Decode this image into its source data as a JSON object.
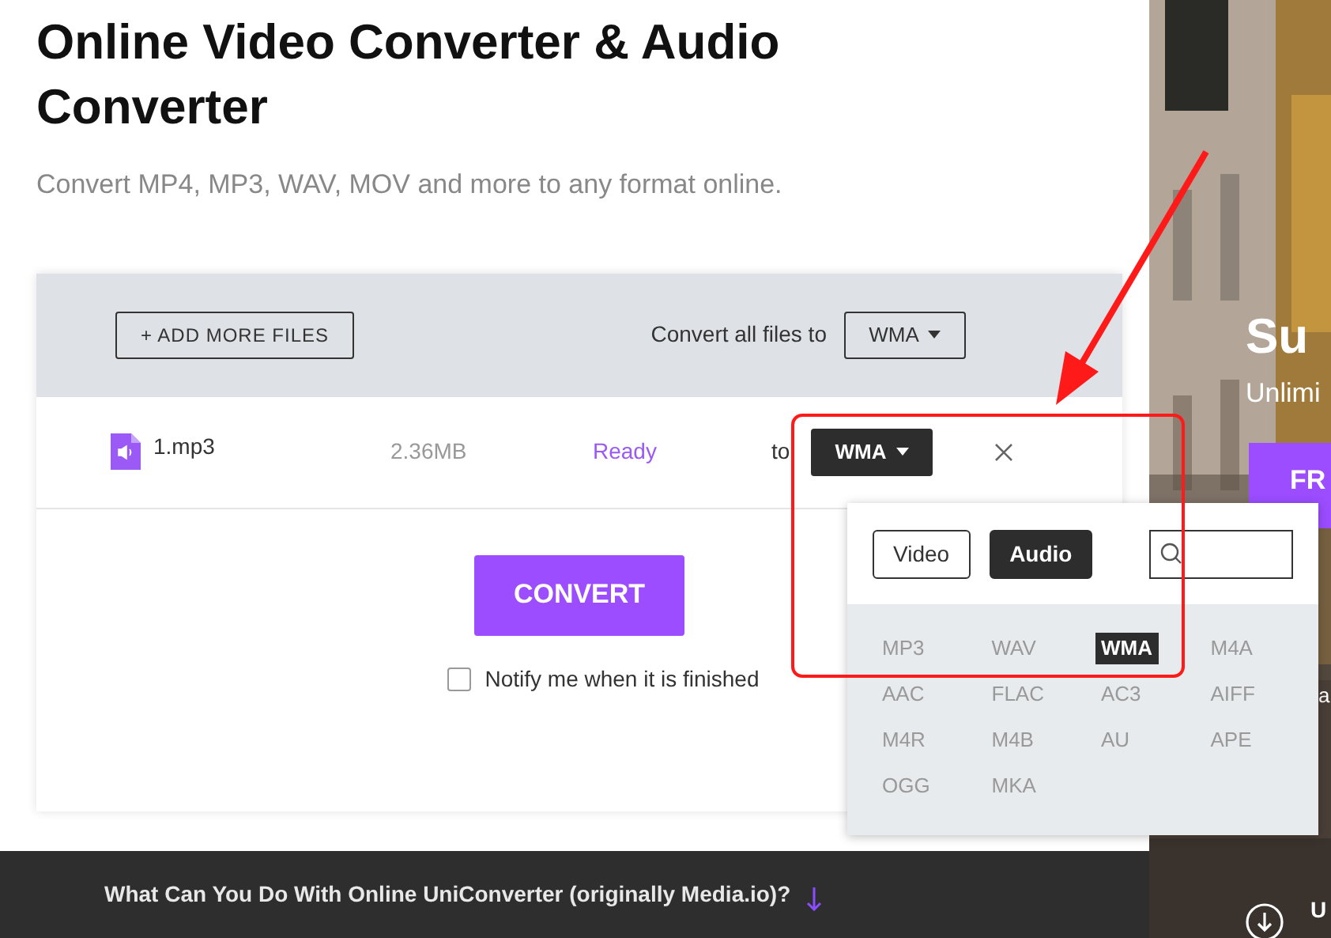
{
  "title": "Online Video Converter & Audio Converter",
  "subtitle": "Convert MP4, MP3, WAV, MOV and more to any format online.",
  "converter": {
    "add_button": "+ ADD MORE FILES",
    "convert_all_label": "Convert all files to",
    "convert_all_format": "WMA",
    "file": {
      "name": "1.mp3",
      "size": "2.36MB",
      "status": "Ready",
      "to_label": "to",
      "format": "WMA"
    },
    "convert_button": "CONVERT",
    "notify": {
      "label": "Notify me when it is finished",
      "checked": false
    }
  },
  "format_menu": {
    "tabs": [
      {
        "label": "Video",
        "selected": false
      },
      {
        "label": "Audio",
        "selected": true
      }
    ],
    "formats": [
      {
        "label": "MP3",
        "selected": false
      },
      {
        "label": "WAV",
        "selected": false
      },
      {
        "label": "WMA",
        "selected": true
      },
      {
        "label": "M4A",
        "selected": false
      },
      {
        "label": "AAC",
        "selected": false
      },
      {
        "label": "FLAC",
        "selected": false
      },
      {
        "label": "AC3",
        "selected": false
      },
      {
        "label": "AIFF",
        "selected": false
      },
      {
        "label": "M4R",
        "selected": false
      },
      {
        "label": "M4B",
        "selected": false
      },
      {
        "label": "AU",
        "selected": false
      },
      {
        "label": "APE",
        "selected": false
      },
      {
        "label": "OGG",
        "selected": false
      },
      {
        "label": "MKA",
        "selected": false
      }
    ]
  },
  "bottom_bar": {
    "text": "What Can You Do With Online UniConverter (originally Media.io)?"
  },
  "promo": {
    "heading": "Su",
    "subheading": "Unlimi",
    "button": "FR",
    "line_2": "a",
    "footer": "U"
  }
}
